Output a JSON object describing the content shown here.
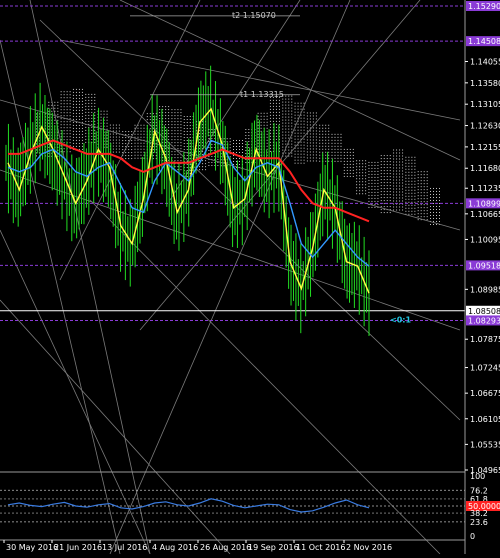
{
  "chart_data": [
    {
      "type": "line",
      "name": "",
      "ylim": [
        1.04965,
        1.1529
      ],
      "y_ticks": [
        "1.15290",
        "1.14508",
        "1.14055",
        "1.13580",
        "1.13105",
        "1.12630",
        "1.12155",
        "1.11680",
        "1.11235",
        "1.10899",
        "1.10665",
        "1.10095",
        "1.09518",
        "1.08985",
        "1.08508",
        "1.08293",
        "1.07875",
        "1.07245",
        "1.06675",
        "1.06105",
        "1.05535",
        "1.04965"
      ],
      "x_labels": [
        "30 May 2016",
        "21 Jun 2016",
        "13 Jul 2016",
        "4 Aug 2016",
        "26 Aug 2016",
        "19 Sep 2016",
        "11 Oct 2016",
        "2 Nov 2016"
      ],
      "horizontal_levels": [
        {
          "value": 1.1529,
          "label": "1.15290",
          "color": "#8a3bd6"
        },
        {
          "value": 1.14508,
          "label": "1.14508",
          "color": "#8a3bd6"
        },
        {
          "value": 1.10899,
          "label": "1.10899",
          "color": "#8a3bd6"
        },
        {
          "value": 1.09518,
          "label": "1.09518",
          "color": "#8a3bd6"
        },
        {
          "value": 1.08508,
          "label": "1.08508",
          "color": "#ffffff"
        },
        {
          "value": 1.08293,
          "label": "1.08293",
          "color": "#8a3bd6"
        }
      ],
      "annotations": [
        {
          "text": "t2 1.15070",
          "value": 1.1507
        },
        {
          "text": "t1 1.13315",
          "value": 1.13315
        },
        {
          "text": "<0:1",
          "color": "#22c6e0"
        }
      ],
      "series": [
        {
          "color": "#ffff44",
          "values": [
            1.118,
            1.112,
            1.12,
            1.126,
            1.121,
            1.115,
            1.109,
            1.114,
            1.121,
            1.117,
            1.104,
            1.1,
            1.11,
            1.125,
            1.119,
            1.107,
            1.112,
            1.127,
            1.13,
            1.122,
            1.108,
            1.11,
            1.121,
            1.115,
            1.118,
            1.096,
            1.09,
            1.099,
            1.112,
            1.108,
            1.096,
            1.095,
            1.089
          ]
        },
        {
          "color": "#3399ff",
          "values": [
            1.117,
            1.116,
            1.117,
            1.12,
            1.121,
            1.119,
            1.116,
            1.115,
            1.117,
            1.118,
            1.113,
            1.108,
            1.107,
            1.114,
            1.118,
            1.116,
            1.114,
            1.118,
            1.123,
            1.122,
            1.117,
            1.114,
            1.117,
            1.118,
            1.117,
            1.109,
            1.1,
            1.097,
            1.1,
            1.103,
            1.1,
            1.097,
            1.095
          ]
        },
        {
          "color": "#ff2222",
          "values": [
            1.12,
            1.12,
            1.121,
            1.122,
            1.123,
            1.122,
            1.121,
            1.12,
            1.12,
            1.12,
            1.119,
            1.117,
            1.116,
            1.117,
            1.118,
            1.118,
            1.118,
            1.119,
            1.12,
            1.121,
            1.12,
            1.119,
            1.119,
            1.119,
            1.119,
            1.116,
            1.112,
            1.109,
            1.108,
            1.108,
            1.107,
            1.106,
            1.105
          ]
        }
      ],
      "price_bars_color": "#22dd22"
    },
    {
      "type": "line",
      "name": "oscillator",
      "ylim": [
        0,
        100
      ],
      "y_ticks": [
        "100",
        "76.2",
        "61.8",
        "50.0000",
        "38.2",
        "23.6",
        "0"
      ],
      "levels": [
        76.2,
        61.8,
        50,
        38.2,
        23.6
      ],
      "current_value_label": "50.0000",
      "current_value_color": "#ff2222",
      "series": [
        {
          "color": "#3a7be0",
          "values": [
            52,
            55,
            51,
            49,
            53,
            56,
            50,
            48,
            52,
            54,
            47,
            45,
            49,
            55,
            57,
            52,
            50,
            55,
            62,
            58,
            51,
            47,
            50,
            53,
            52,
            44,
            40,
            42,
            48,
            55,
            60,
            52,
            47
          ]
        }
      ]
    }
  ]
}
